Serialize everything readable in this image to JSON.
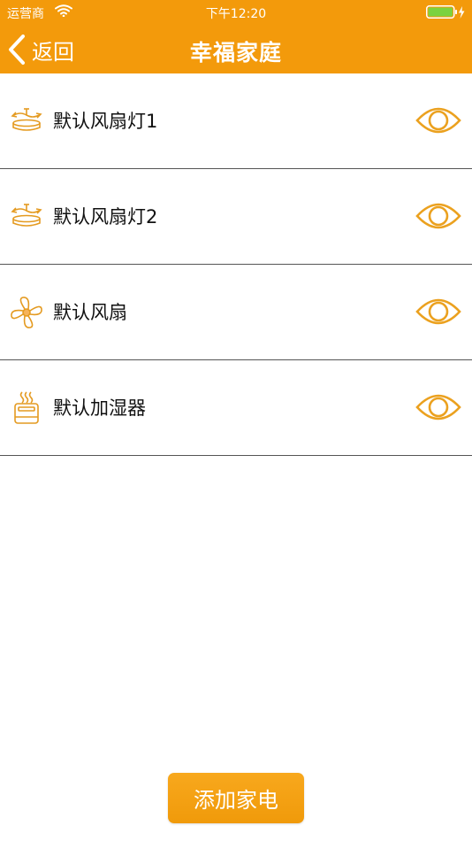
{
  "status_bar": {
    "carrier": "运营商",
    "time": "下午12:20"
  },
  "nav": {
    "back_label": "返回",
    "title": "幸福家庭"
  },
  "devices": [
    {
      "name": "默认风扇灯1",
      "icon": "fan-light-icon"
    },
    {
      "name": "默认风扇灯2",
      "icon": "fan-light-icon"
    },
    {
      "name": "默认风扇",
      "icon": "fan-icon"
    },
    {
      "name": "默认加湿器",
      "icon": "humidifier-icon"
    }
  ],
  "add_button": {
    "label": "添加家电"
  },
  "colors": {
    "accent": "#F39A0B",
    "divider": "#555555",
    "battery": "#7CD23F"
  }
}
